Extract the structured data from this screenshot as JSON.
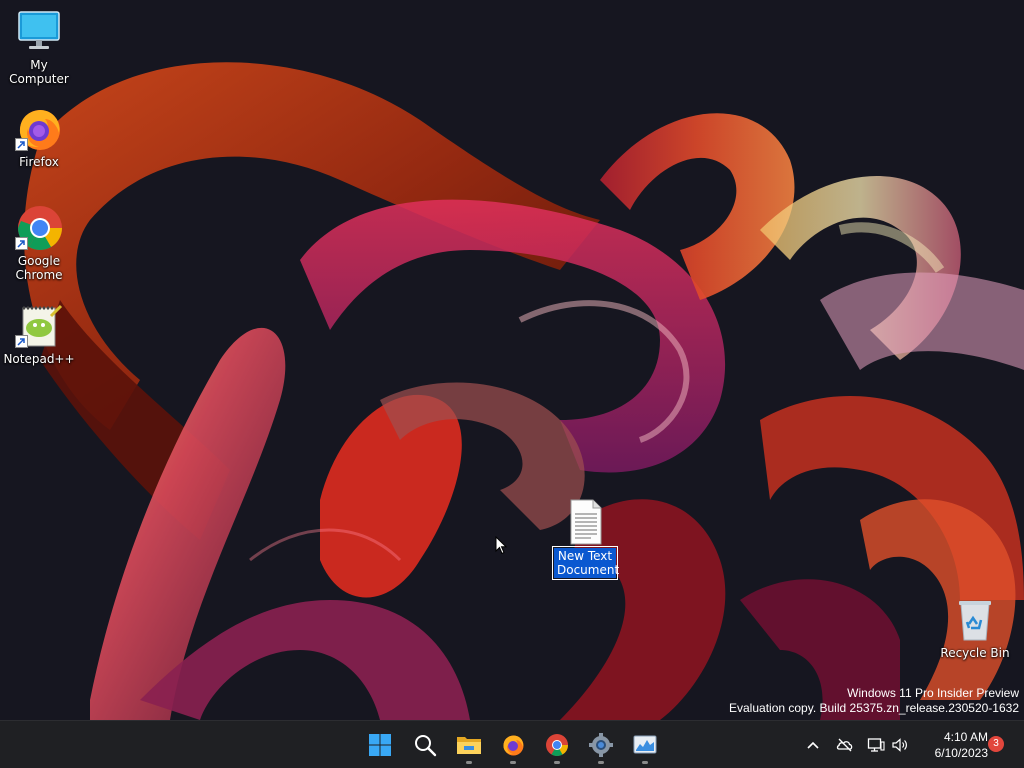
{
  "desktop": {
    "icons": [
      {
        "label": "My Computer",
        "icon": "monitor-icon"
      },
      {
        "label": "Firefox",
        "icon": "firefox-icon"
      },
      {
        "label": "Google Chrome",
        "icon": "chrome-icon"
      },
      {
        "label": "Notepad++",
        "icon": "notepadpp-icon"
      },
      {
        "label": "New Text Document",
        "icon": "text-document-icon",
        "selected": true
      },
      {
        "label": "Recycle Bin",
        "icon": "recycle-bin-icon"
      }
    ]
  },
  "watermark": {
    "line1": "Windows 11 Pro Insider Preview",
    "line2": "Evaluation copy. Build 25375.zn_release.230520-1632"
  },
  "taskbar": {
    "apps": [
      {
        "name": "start-button",
        "icon": "windows-logo-icon"
      },
      {
        "name": "search-button",
        "icon": "search-icon"
      },
      {
        "name": "file-explorer-button",
        "icon": "folder-icon",
        "running": true
      },
      {
        "name": "firefox-taskbar-button",
        "icon": "firefox-icon",
        "running": true
      },
      {
        "name": "chrome-taskbar-button",
        "icon": "chrome-icon",
        "running": true
      },
      {
        "name": "settings-taskbar-button",
        "icon": "gear-icon",
        "running": true
      },
      {
        "name": "task-manager-taskbar-button",
        "icon": "task-manager-icon",
        "running": true
      }
    ],
    "tray": {
      "time": "4:10 AM",
      "date": "6/10/2023",
      "notification_count": "3"
    }
  },
  "colors": {
    "selection": "#0a58d0",
    "taskbar": "#1f2023",
    "notification_badge": "#e2463c"
  }
}
